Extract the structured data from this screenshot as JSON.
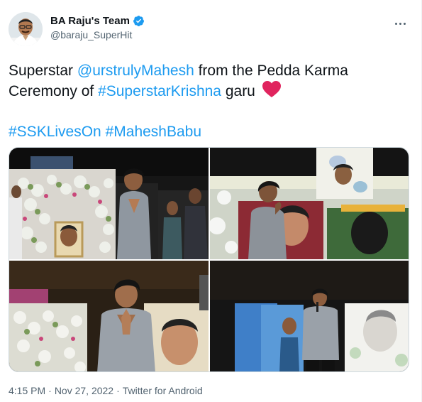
{
  "author": {
    "display_name": "BA Raju's Team",
    "handle": "@baraju_SuperHit",
    "verified": true
  },
  "tweet": {
    "line1": [
      {
        "text": "Superstar ",
        "type": "text"
      },
      {
        "text": "@urstrulyMahesh",
        "type": "mention"
      },
      {
        "text": " from the Pedda Karma",
        "type": "text"
      }
    ],
    "line2": [
      {
        "text": "Ceremony of ",
        "type": "text"
      },
      {
        "text": "#SuperstarKrishna",
        "type": "hashtag"
      },
      {
        "text": " garu ",
        "type": "text"
      }
    ],
    "line3": [
      {
        "text": "#SSKLivesOn",
        "type": "hashtag"
      },
      {
        "text": " ",
        "type": "text"
      },
      {
        "text": "#MaheshBabu",
        "type": "hashtag"
      }
    ],
    "emoji": "heart-icon"
  },
  "meta": {
    "time": "4:15 PM",
    "sep1": "·",
    "date": "Nov 27, 2022",
    "sep2": "·",
    "source": "Twitter for Android"
  },
  "colors": {
    "link": "#1d9bf0",
    "heart": "#e0245e",
    "muted": "#536471"
  }
}
